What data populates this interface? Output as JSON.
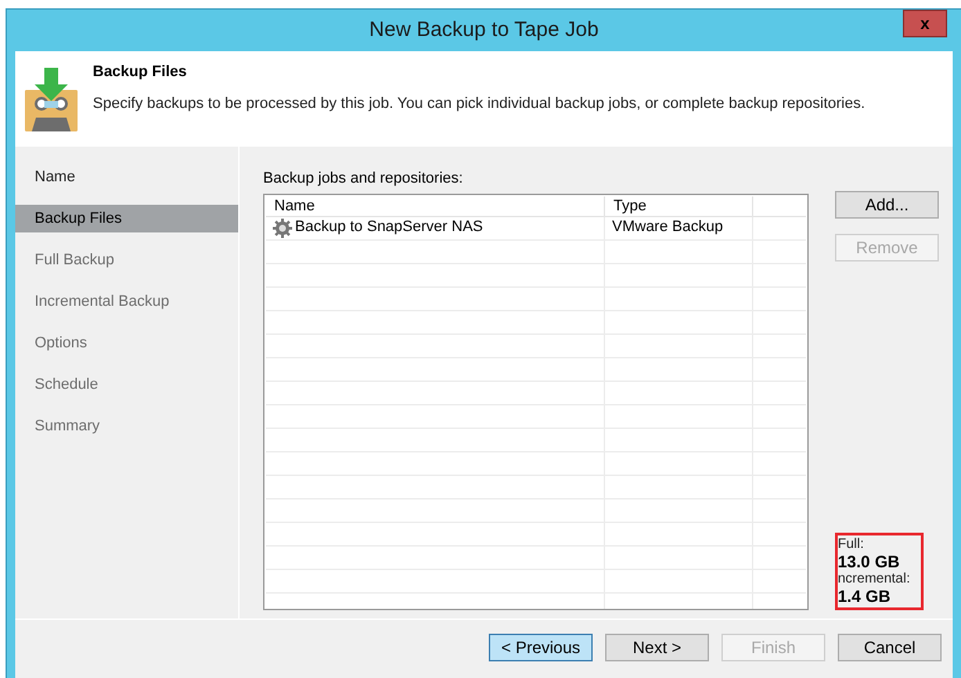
{
  "window": {
    "title": "New Backup to Tape Job",
    "close": "x"
  },
  "header": {
    "title": "Backup Files",
    "description": "Specify backups to be processed by this job. You can pick individual backup jobs, or complete backup repositories."
  },
  "sidebar": {
    "items": [
      {
        "label": "Name",
        "selected": false
      },
      {
        "label": "Backup Files",
        "selected": true
      },
      {
        "label": "Full Backup",
        "selected": false
      },
      {
        "label": "Incremental Backup",
        "selected": false
      },
      {
        "label": "Options",
        "selected": false
      },
      {
        "label": "Schedule",
        "selected": false
      },
      {
        "label": "Summary",
        "selected": false
      }
    ]
  },
  "table": {
    "label": "Backup jobs and repositories:",
    "columns": [
      "Name",
      "Type"
    ],
    "rows": [
      {
        "name": "Backup to SnapServer NAS",
        "type": "VMware Backup"
      }
    ]
  },
  "side_buttons": [
    {
      "label": "Add...",
      "disabled": false
    },
    {
      "label": "Remove",
      "disabled": true
    }
  ],
  "summary": [
    {
      "kind": "label",
      "text": "Full:"
    },
    {
      "kind": "value",
      "text": "13.0 GB"
    },
    {
      "kind": "label",
      "text": "ncremental:"
    },
    {
      "kind": "value",
      "text": "1.4 GB"
    }
  ],
  "footer_buttons": [
    {
      "label": "< Previous",
      "disabled": false,
      "focused": true
    },
    {
      "label": "Next >",
      "disabled": false,
      "focused": false
    },
    {
      "label": "Finish",
      "disabled": true,
      "focused": false
    },
    {
      "label": "Cancel",
      "disabled": false,
      "focused": false
    }
  ]
}
